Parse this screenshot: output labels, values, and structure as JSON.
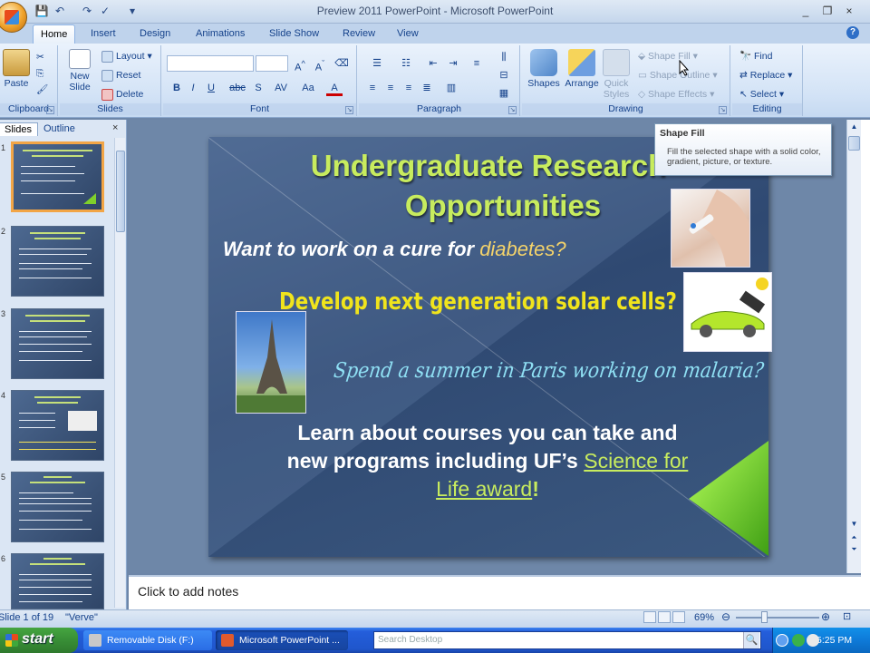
{
  "window": {
    "title": "Preview 2011 PowerPoint - Microsoft PowerPoint",
    "controls": [
      "_",
      "❐",
      "×"
    ]
  },
  "ribbon_tabs": [
    "Home",
    "Insert",
    "Design",
    "Animations",
    "Slide Show",
    "Review",
    "View"
  ],
  "clipboard": {
    "paste": "Paste",
    "label": "Clipboard"
  },
  "slides_group": {
    "new_slide_1": "New",
    "new_slide_2": "Slide",
    "layout": "Layout",
    "reset": "Reset",
    "delete": "Delete",
    "label": "Slides"
  },
  "font_group": {
    "label": "Font",
    "bold": "B",
    "italic": "I",
    "underline": "U",
    "strike": "abc",
    "shadow": "S",
    "spacing": "AV",
    "case": "Aa",
    "color": "A"
  },
  "paragraph_group": {
    "label": "Paragraph"
  },
  "drawing_group": {
    "shapes": "Shapes",
    "arrange": "Arrange",
    "quick_styles_1": "Quick",
    "quick_styles_2": "Styles",
    "shape_fill": "Shape Fill",
    "shape_outline": "Shape Outline",
    "shape_effects": "Shape Effects",
    "label": "Drawing"
  },
  "editing_group": {
    "find": "Find",
    "replace": "Replace",
    "select": "Select",
    "label": "Editing"
  },
  "tooltip": {
    "title": "Shape Fill",
    "body": "Fill the selected shape with a solid color, gradient, picture, or texture."
  },
  "pane_tabs": {
    "slides": "Slides",
    "outline": "Outline",
    "close": "×"
  },
  "thumbnails": [
    {
      "num": "1",
      "title": "Undergraduate Research Opportunities"
    },
    {
      "num": "2",
      "title": "What is Undergraduate Research?"
    },
    {
      "num": "3",
      "title": "Why Seek and Continue Undergraduate Research?"
    },
    {
      "num": "4",
      "title": "Types of Research Opportunities"
    },
    {
      "num": "5",
      "title": "UF-HHMI Science for Life Program"
    },
    {
      "num": "6",
      "title": "UF-HHMI Science for Life Program"
    }
  ],
  "slide": {
    "title_line1": "Undergraduate Research",
    "title_line2": "Opportunities",
    "line_diabetes_pre": "Want to work on a cure for ",
    "line_diabetes_word": "diabetes?",
    "line_solar": "Develop next generation solar cells?",
    "line_paris": "Spend a summer in Paris working on malaria?",
    "body_line1": "Learn about courses you can take and",
    "body_line2_pre": "new programs including UF’s ",
    "link_part1": "Science for",
    "link_part2": "Life award",
    "body_end": "!"
  },
  "notes_placeholder": "Click to add notes",
  "status": {
    "slide_of": "Slide 1 of 19",
    "theme": "\"Verve\"",
    "zoom": "69%"
  },
  "taskbar": {
    "start": "start",
    "items": [
      "Removable Disk (F:)",
      "Microsoft PowerPoint ..."
    ],
    "search_placeholder": "Search Desktop",
    "clock": "5:25 PM"
  },
  "colors": {
    "slide_title": "#c8ec5e",
    "solar_text": "#f0e41c",
    "paris_text": "#8fe0f4",
    "accent_green": "#7fd02b"
  }
}
